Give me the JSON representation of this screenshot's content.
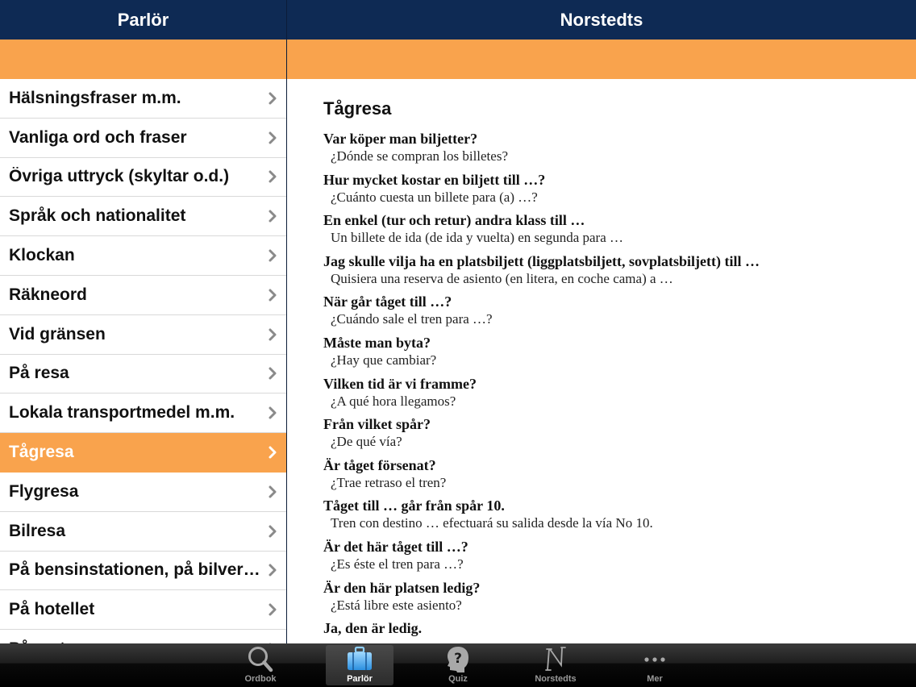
{
  "left_pane": {
    "title": "Parlör",
    "items": [
      {
        "label": "Hälsningsfraser m.m.",
        "selected": false
      },
      {
        "label": "Vanliga ord och fraser",
        "selected": false
      },
      {
        "label": "Övriga uttryck (skyltar o.d.)",
        "selected": false
      },
      {
        "label": "Språk och nationalitet",
        "selected": false
      },
      {
        "label": "Klockan",
        "selected": false
      },
      {
        "label": "Räkneord",
        "selected": false
      },
      {
        "label": "Vid gränsen",
        "selected": false
      },
      {
        "label": "På resa",
        "selected": false
      },
      {
        "label": "Lokala transportmedel m.m.",
        "selected": false
      },
      {
        "label": "Tågresa",
        "selected": true
      },
      {
        "label": "Flygresa",
        "selected": false
      },
      {
        "label": "Bilresa",
        "selected": false
      },
      {
        "label": "På bensinstationen, på bilverkstaden",
        "selected": false
      },
      {
        "label": "På hotellet",
        "selected": false
      },
      {
        "label": "På restaurangen",
        "selected": false
      }
    ]
  },
  "right_pane": {
    "title": "Norstedts",
    "section_title": "Tågresa",
    "phrases": [
      {
        "sv": "Var köper man biljetter?",
        "es": "¿Dónde se compran los billetes?"
      },
      {
        "sv": "Hur mycket kostar en biljett till …?",
        "es": "¿Cuánto cuesta un billete para (a) …?"
      },
      {
        "sv": "En enkel (tur och retur) andra klass till …",
        "es": "Un billete de ida (de ida y vuelta) en segunda para …"
      },
      {
        "sv": "Jag skulle vilja ha en platsbiljett (liggplatsbiljett, sovplatsbiljett) till …",
        "es": "Quisiera una reserva de asiento (en litera, en coche cama) a …"
      },
      {
        "sv": "När går tåget till …?",
        "es": "¿Cuándo sale el tren para …?"
      },
      {
        "sv": "Måste man byta?",
        "es": "¿Hay que cambiar?"
      },
      {
        "sv": "Vilken tid är vi framme?",
        "es": "¿A qué hora llegamos?"
      },
      {
        "sv": "Från vilket spår?",
        "es": "¿De qué vía?"
      },
      {
        "sv": "Är tåget försenat?",
        "es": "¿Trae retraso el tren?"
      },
      {
        "sv": "Tåget till … går från spår 10.",
        "es": "Tren con destino … efectuará su salida desde la vía No 10."
      },
      {
        "sv": "Är det här tåget till …?",
        "es": "¿Es éste el tren para …?"
      },
      {
        "sv": "Är den här platsen ledig?",
        "es": "¿Está libre este asiento?"
      },
      {
        "sv": "Ja, den är ledig.",
        "es": ""
      }
    ]
  },
  "tabbar": {
    "active": "Parlör",
    "tabs": [
      {
        "label": "Ordbok",
        "icon": "search-icon"
      },
      {
        "label": "Parlör",
        "icon": "suitcase-icon"
      },
      {
        "label": "Quiz",
        "icon": "head-question-icon"
      },
      {
        "label": "Norstedts",
        "icon": "norstedts-logo-icon"
      },
      {
        "label": "Mer",
        "icon": "more-dots-icon"
      }
    ]
  },
  "colors": {
    "navbar": "#0e2a54",
    "accent_orange": "#f9a34d",
    "selected_text": "#ffffff",
    "tabbar": "#111111"
  }
}
